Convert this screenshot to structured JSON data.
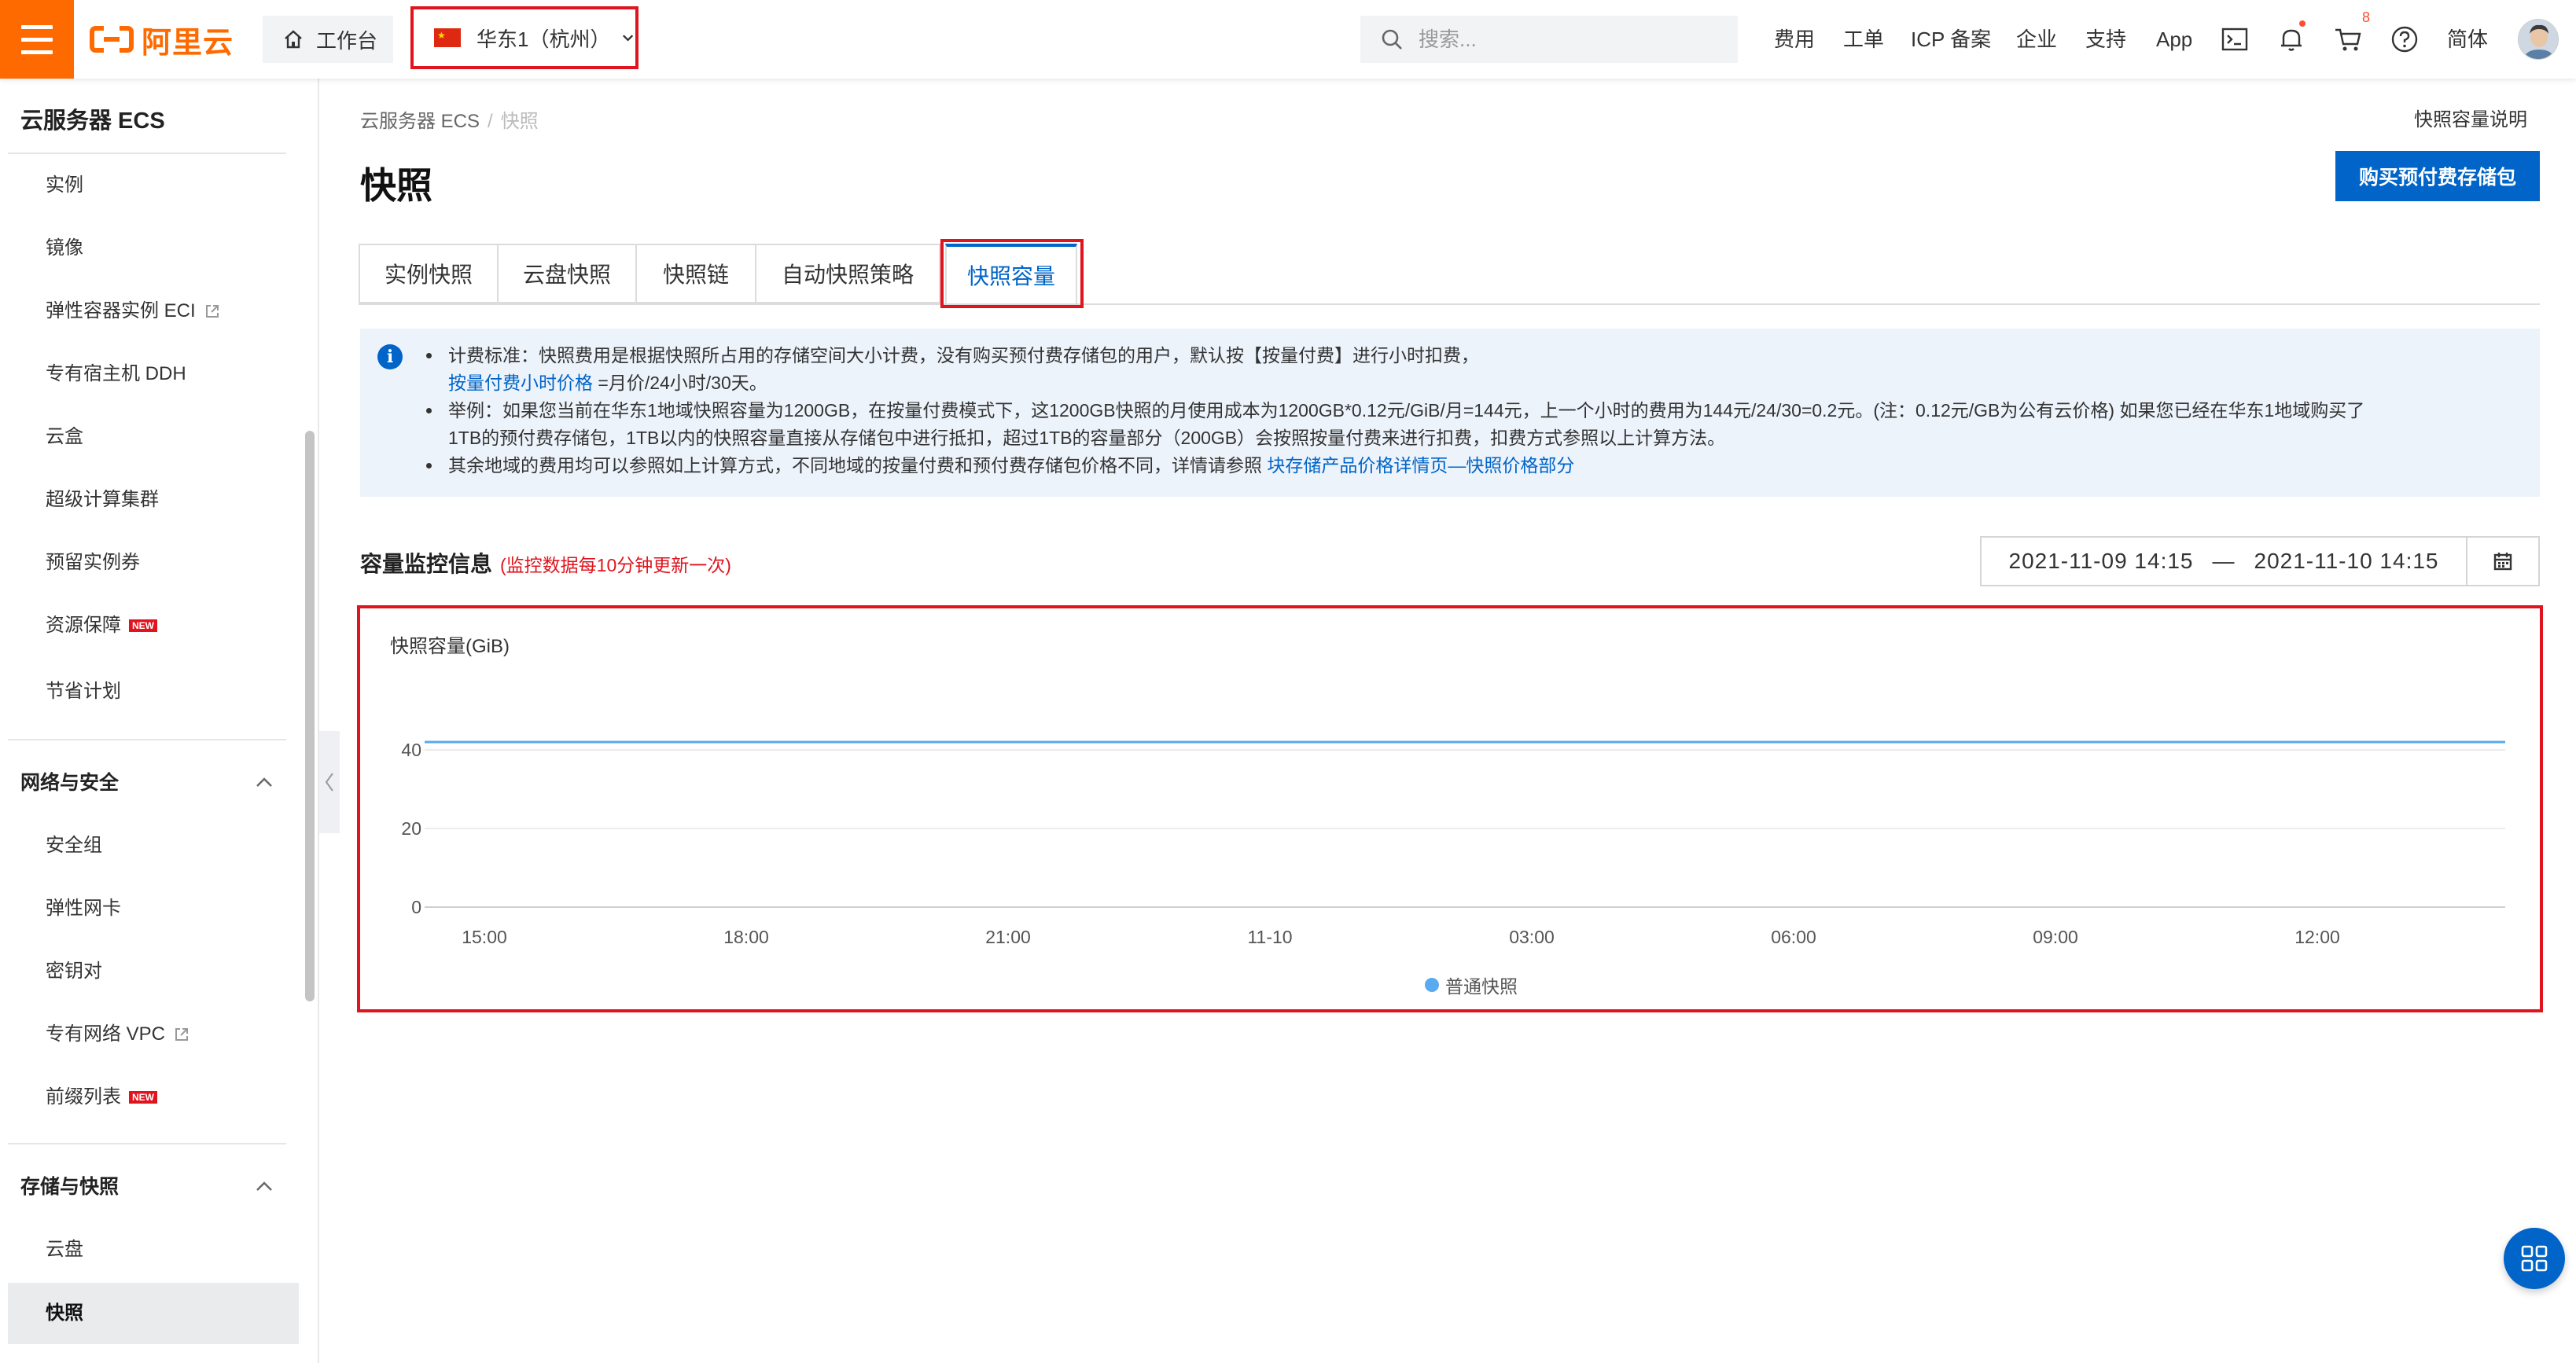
{
  "topbar": {
    "logo_text": "阿里云",
    "workbench": "工作台",
    "region": "华东1（杭州）",
    "search_placeholder": "搜索...",
    "nav": [
      "费用",
      "工单",
      "ICP 备案",
      "企业",
      "支持",
      "App"
    ],
    "cart_count": "8",
    "lang": "简体"
  },
  "sidebar": {
    "title": "云服务器 ECS",
    "items_top": [
      "实例",
      "镜像",
      "弹性容器实例 ECI",
      "专有宿主机 DDH",
      "云盒",
      "超级计算集群",
      "预留实例券",
      "资源保障",
      "节省计划"
    ],
    "group_network": "网络与安全",
    "items_network": [
      "安全组",
      "弹性网卡",
      "密钥对",
      "专有网络 VPC",
      "前缀列表"
    ],
    "group_storage": "存储与快照",
    "items_storage": [
      "云盘",
      "快照"
    ],
    "new_badge": "NEW"
  },
  "main": {
    "breadcrumb": [
      "云服务器 ECS",
      "快照"
    ],
    "help_link": "快照容量说明",
    "title": "快照",
    "buy_button": "购买预付费存储包",
    "tabs": [
      "实例快照",
      "云盘快照",
      "快照链",
      "自动快照策略",
      "快照容量"
    ],
    "active_tab": "快照容量",
    "notice": {
      "l1": "计费标准：快照费用是根据快照所占用的存储空间大小计费，没有购买预付费存储包的用户，默认按【按量付费】进行小时扣费，",
      "l2_link": "按量付费小时价格",
      "l2_text": " =月价/24小时/30天。",
      "l3": "举例：如果您当前在华东1地域快照容量为1200GB，在按量付费模式下，这1200GB快照的月使用成本为1200GB*0.12元/GiB/月=144元，上一个小时的费用为144元/24/30=0.2元。(注：0.12元/GB为公有云价格) 如果您已经在华东1地域购买了",
      "l4": "1TB的预付费存储包，1TB以内的快照容量直接从存储包中进行抵扣，超过1TB的容量部分（200GB）会按照按量付费来进行扣费，扣费方式参照以上计算方法。",
      "l5_text": "其余地域的费用均可以参照如上计算方式，不同地域的按量付费和预付费存储包价格不同，详情请参照 ",
      "l5_link": "块存储产品价格详情页—快照价格部分"
    },
    "section_title": "容量监控信息",
    "section_note": "(监控数据每10分钟更新一次)",
    "date_start": "2021-11-09 14:15",
    "date_sep": "—",
    "date_end": "2021-11-10 14:15"
  },
  "chart_data": {
    "type": "line",
    "ylabel": "快照容量(GiB)",
    "x_ticks": [
      "15:00",
      "18:00",
      "21:00",
      "11-10",
      "03:00",
      "06:00",
      "09:00",
      "12:00"
    ],
    "y_ticks": [
      0,
      20,
      40
    ],
    "ylim": [
      0,
      40
    ],
    "series": [
      {
        "name": "普通快照",
        "color": "#5aaaf0",
        "values": [
          42,
          42,
          42,
          42,
          42,
          42,
          42,
          42,
          42,
          42
        ]
      }
    ],
    "legend": "bottom-center",
    "grid": true
  },
  "colors": {
    "accent": "#0064c8",
    "brand": "#ff6a00",
    "highlight": "#e0141e",
    "series": "#5aaaf0"
  }
}
